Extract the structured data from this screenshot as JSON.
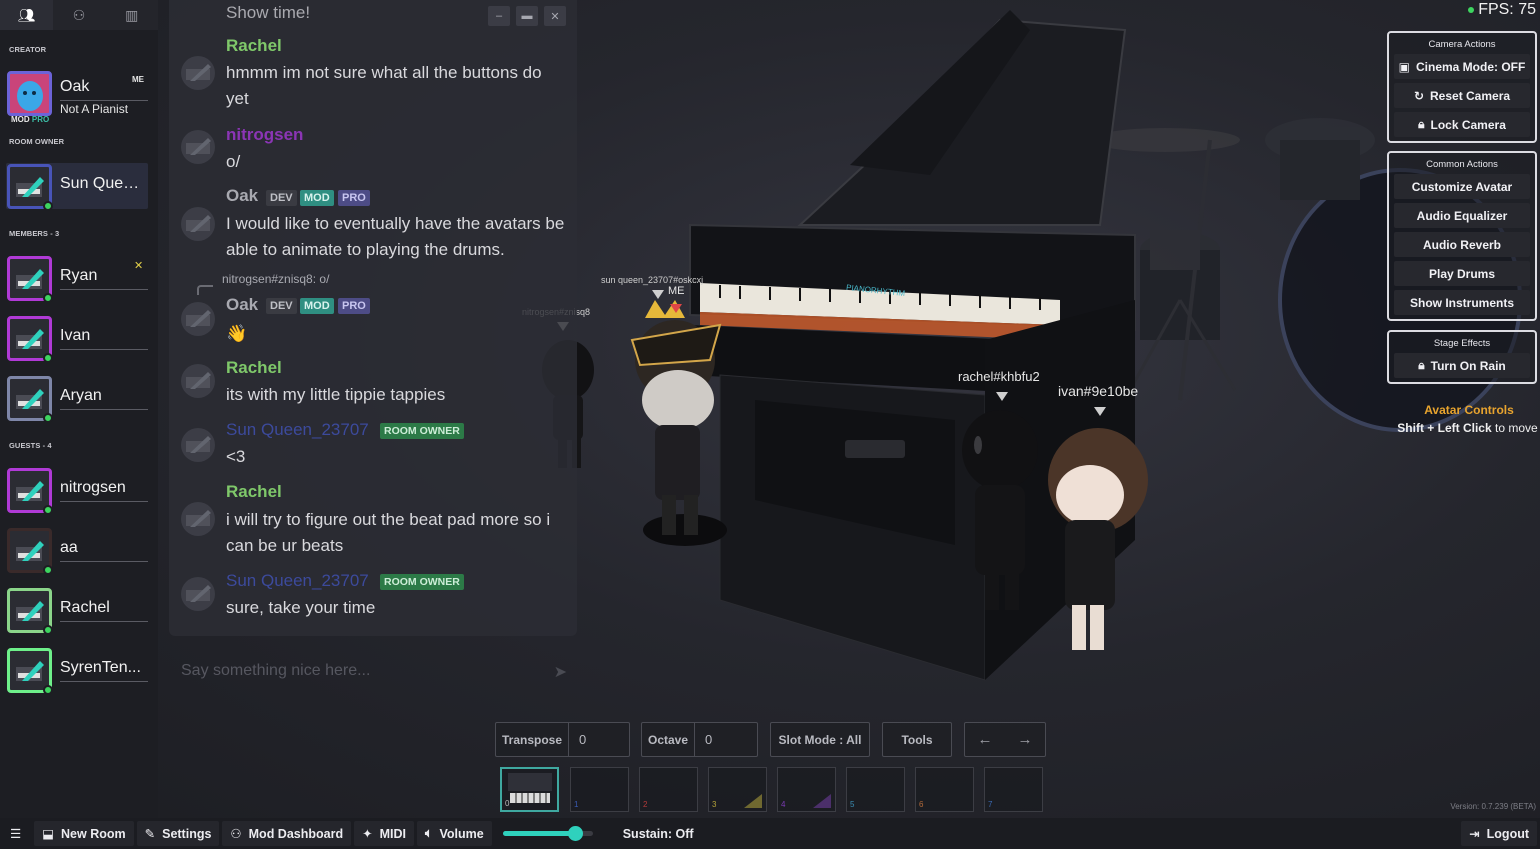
{
  "sidebar": {
    "sections": {
      "creator": "CREATOR",
      "room_owner": "ROOM OWNER",
      "members": "MEMBERS - 3",
      "guests": "GUESTS - 4"
    },
    "creator": {
      "name": "Oak",
      "subtitle": "Not A Pianist",
      "me": "ME",
      "badge_mod": "MOD",
      "badge_pro": "PRO"
    },
    "room_owner": {
      "name": "Sun Queen..."
    },
    "members": [
      {
        "name": "Ryan"
      },
      {
        "name": "Ivan"
      },
      {
        "name": "Aryan"
      }
    ],
    "guests": [
      {
        "name": "nitrogsen"
      },
      {
        "name": "aa"
      },
      {
        "name": "Rachel"
      },
      {
        "name": "SyrenTen..."
      }
    ]
  },
  "chat": {
    "top_cut_text": "Show time!",
    "messages": [
      {
        "name": "Rachel",
        "text": "hmmm im not sure what all the buttons do yet",
        "color": "#7fc86a"
      },
      {
        "name": "nitrogsen",
        "text": "o/",
        "color": "#9b3fc0"
      },
      {
        "name": "Oak",
        "tags": [
          "DEV",
          "MOD",
          "PRO"
        ],
        "text": "I would like to eventually have the avatars be able to animate to playing the drums."
      },
      {
        "reply_to": "nitrogsen#znisq8: o/",
        "name": "Oak",
        "tags": [
          "DEV",
          "MOD",
          "PRO"
        ],
        "text": "👋"
      },
      {
        "name": "Rachel",
        "text": "its with my little tippie tappies",
        "color": "#7fc86a"
      },
      {
        "name": "Sun Queen_23707",
        "tag": "ROOM OWNER",
        "text": "<3",
        "color": "#3c4a9c"
      },
      {
        "name": "Rachel",
        "text": "i will try to figure out the beat pad more so i can be ur beats",
        "color": "#7fc86a"
      },
      {
        "name": "Sun Queen_23707",
        "tag": "ROOM OWNER",
        "text": "sure, take your time",
        "color": "#3c4a9c"
      }
    ],
    "input_placeholder": "Say something nice here..."
  },
  "scene": {
    "labels": {
      "sunqueen": "sun queen_23707#oskcxj",
      "me": "ME",
      "nitrogsen": "nitrogsen#znisq8",
      "rachel": "rachel#khbfu2",
      "ivan": "ivan#9e10be",
      "piano_brand": "PIANORHYTHM"
    }
  },
  "fps": "FPS: 75",
  "camera_actions": {
    "title": "Camera Actions",
    "cinema": "Cinema Mode: OFF",
    "reset": "Reset Camera",
    "lock": "Lock Camera"
  },
  "common_actions": {
    "title": "Common Actions",
    "customize": "Customize Avatar",
    "equalizer": "Audio Equalizer",
    "reverb": "Audio Reverb",
    "drums": "Play Drums",
    "instruments": "Show Instruments"
  },
  "stage_effects": {
    "title": "Stage Effects",
    "rain": "Turn On Rain"
  },
  "avatar_controls": {
    "title": "Avatar Controls",
    "combo": "Shift + Left Click",
    "action": " to move"
  },
  "piano_controls": {
    "transpose_label": "Transpose",
    "transpose_value": "0",
    "octave_label": "Octave",
    "octave_value": "0",
    "slot_mode": "Slot Mode : All",
    "tools": "Tools",
    "prev_arrow": "←",
    "next_arrow": "→",
    "slots": [
      "0",
      "1",
      "2",
      "3",
      "4",
      "5",
      "6",
      "7"
    ]
  },
  "version": "Version: 0.7.239 (BETA)",
  "bottombar": {
    "new_room": "New Room",
    "settings": "Settings",
    "mod_dashboard": "Mod Dashboard",
    "midi": "MIDI",
    "volume": "Volume",
    "volume_level": 0.8,
    "sustain": "Sustain: Off",
    "logout": "Logout"
  },
  "colors": {
    "accent": "#2fd1bd",
    "online": "#3dd55f",
    "guest_border": "#b03ad6",
    "creator_border": "#6c63d8"
  }
}
